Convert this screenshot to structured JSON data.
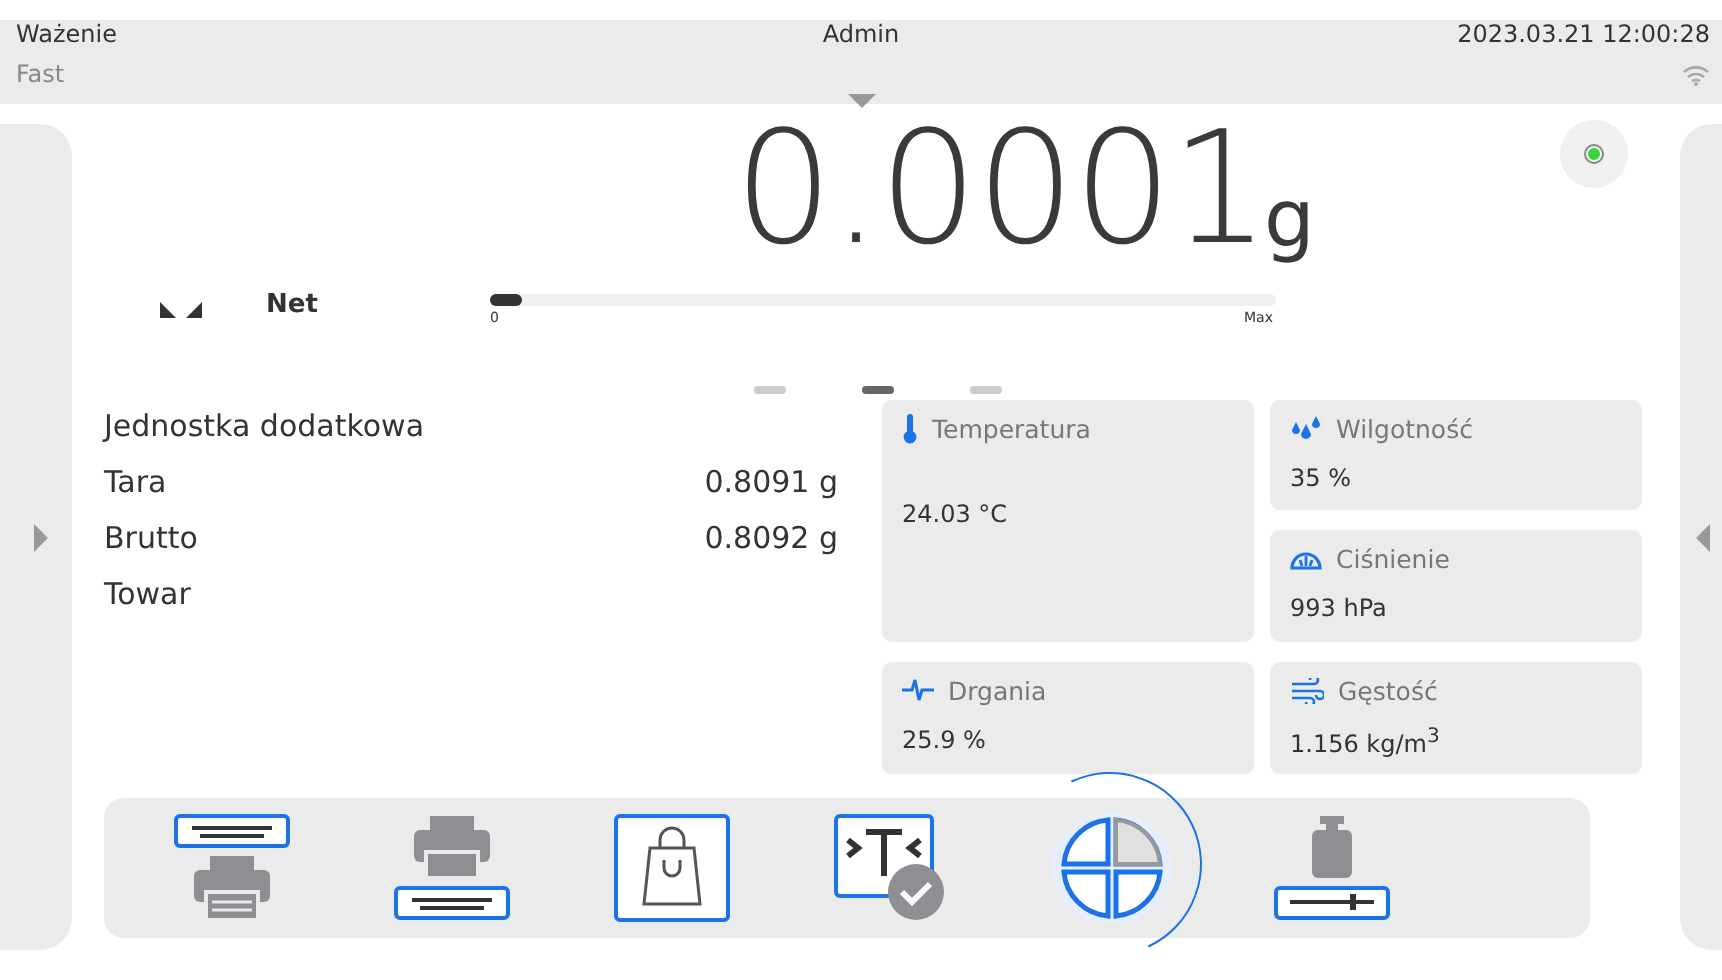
{
  "header": {
    "mode": "Ważenie",
    "profile": "Fast",
    "user": "Admin",
    "datetime": "2023.03.21 12:00:28"
  },
  "display": {
    "value": "0.0001",
    "unit": "g",
    "stable": true,
    "net_label": "Net",
    "bar": {
      "level": 0.04,
      "min_label": "0",
      "max_label": "Max"
    }
  },
  "pages": [
    {
      "selected": false
    },
    {
      "selected": true
    },
    {
      "selected": false
    }
  ],
  "info_rows": [
    {
      "label": "Jednostka dodatkowa",
      "value": ""
    },
    {
      "label": "Tara",
      "value": "0.8091 g"
    },
    {
      "label": "Brutto",
      "value": "0.8092 g"
    },
    {
      "label": "Towar",
      "value": ""
    }
  ],
  "sensors": [
    {
      "kind": "temperature",
      "name": "Temperatura",
      "value": "24.03 °C"
    },
    {
      "kind": "humidity",
      "name": "Wilgotność",
      "value": "35 %"
    },
    {
      "kind": "pressure",
      "name": "Ciśnienie",
      "value": "993 hPa"
    },
    {
      "kind": "vibration",
      "name": "Drgania",
      "value": "25.9 %"
    },
    {
      "kind": "density",
      "name": "Gęstość",
      "value": "1.156 kg/m$^{3}$"
    }
  ],
  "toolbar": [
    {
      "kind": "header-print",
      "pressed": false
    },
    {
      "kind": "footer-print",
      "pressed": false
    },
    {
      "kind": "product",
      "pressed": false
    },
    {
      "kind": "template",
      "pressed": false
    },
    {
      "kind": "statistics",
      "pressed": true
    },
    {
      "kind": "adjustment",
      "pressed": false
    }
  ]
}
